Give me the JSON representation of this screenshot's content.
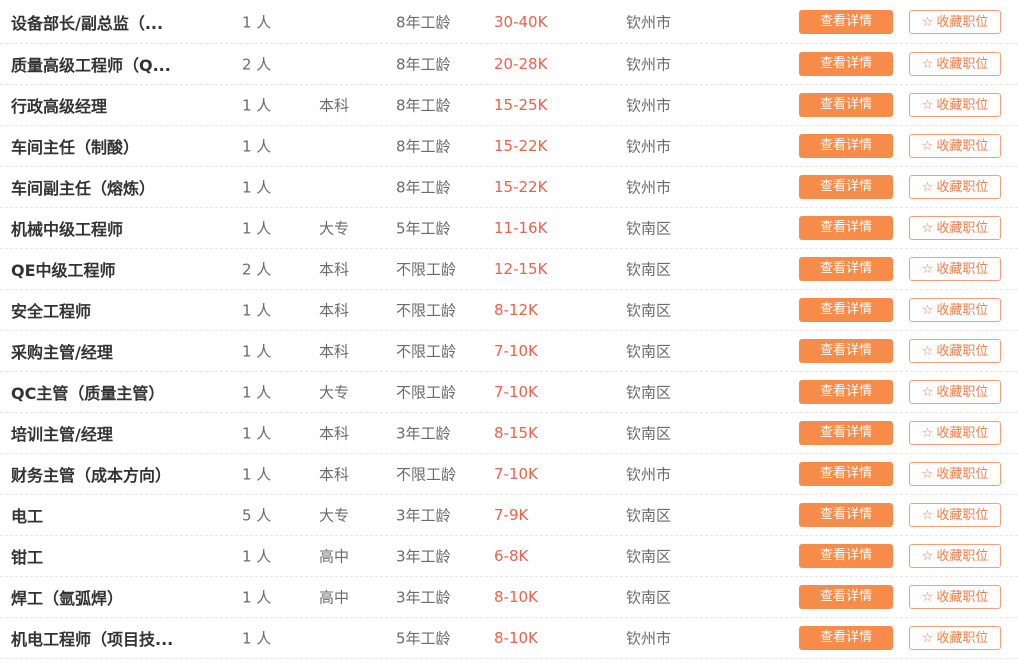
{
  "jobs": [
    {
      "title": "设备部长/副总监（...",
      "count": "1 人",
      "education": "",
      "experience": "8年工龄",
      "salary": "30-40K",
      "location": "钦州市"
    },
    {
      "title": "质量高级工程师（Q...",
      "count": "2 人",
      "education": "",
      "experience": "8年工龄",
      "salary": "20-28K",
      "location": "钦州市"
    },
    {
      "title": "行政高级经理",
      "count": "1 人",
      "education": "本科",
      "experience": "8年工龄",
      "salary": "15-25K",
      "location": "钦州市"
    },
    {
      "title": "车间主任（制酸）",
      "count": "1 人",
      "education": "",
      "experience": "8年工龄",
      "salary": "15-22K",
      "location": "钦州市"
    },
    {
      "title": "车间副主任（熔炼）",
      "count": "1 人",
      "education": "",
      "experience": "8年工龄",
      "salary": "15-22K",
      "location": "钦州市"
    },
    {
      "title": "机械中级工程师",
      "count": "1 人",
      "education": "大专",
      "experience": "5年工龄",
      "salary": "11-16K",
      "location": "钦南区"
    },
    {
      "title": "QE中级工程师",
      "count": "2 人",
      "education": "本科",
      "experience": "不限工龄",
      "salary": "12-15K",
      "location": "钦南区"
    },
    {
      "title": "安全工程师",
      "count": "1 人",
      "education": "本科",
      "experience": "不限工龄",
      "salary": "8-12K",
      "location": "钦南区"
    },
    {
      "title": "采购主管/经理",
      "count": "1 人",
      "education": "本科",
      "experience": "不限工龄",
      "salary": "7-10K",
      "location": "钦南区"
    },
    {
      "title": "QC主管（质量主管）",
      "count": "1 人",
      "education": "大专",
      "experience": "不限工龄",
      "salary": "7-10K",
      "location": "钦南区"
    },
    {
      "title": "培训主管/经理",
      "count": "1 人",
      "education": "本科",
      "experience": "3年工龄",
      "salary": "8-15K",
      "location": "钦南区"
    },
    {
      "title": "财务主管（成本方向）",
      "count": "1 人",
      "education": "本科",
      "experience": "不限工龄",
      "salary": "7-10K",
      "location": "钦州市"
    },
    {
      "title": "电工",
      "count": "5 人",
      "education": "大专",
      "experience": "3年工龄",
      "salary": "7-9K",
      "location": "钦南区"
    },
    {
      "title": "钳工",
      "count": "1 人",
      "education": "高中",
      "experience": "3年工龄",
      "salary": "6-8K",
      "location": "钦南区"
    },
    {
      "title": "焊工（氩弧焊）",
      "count": "1 人",
      "education": "高中",
      "experience": "3年工龄",
      "salary": "8-10K",
      "location": "钦南区"
    },
    {
      "title": "机电工程师（项目技...",
      "count": "1 人",
      "education": "",
      "experience": "5年工龄",
      "salary": "8-10K",
      "location": "钦州市"
    }
  ],
  "buttons": {
    "detail_label": "查看详情",
    "favorite_label": "收藏职位",
    "favorite_icon": "☆"
  },
  "colors": {
    "detail_button_bg": "#f68b4a",
    "favorite_border": "#f3a07a",
    "salary_text": "#f0604a"
  }
}
